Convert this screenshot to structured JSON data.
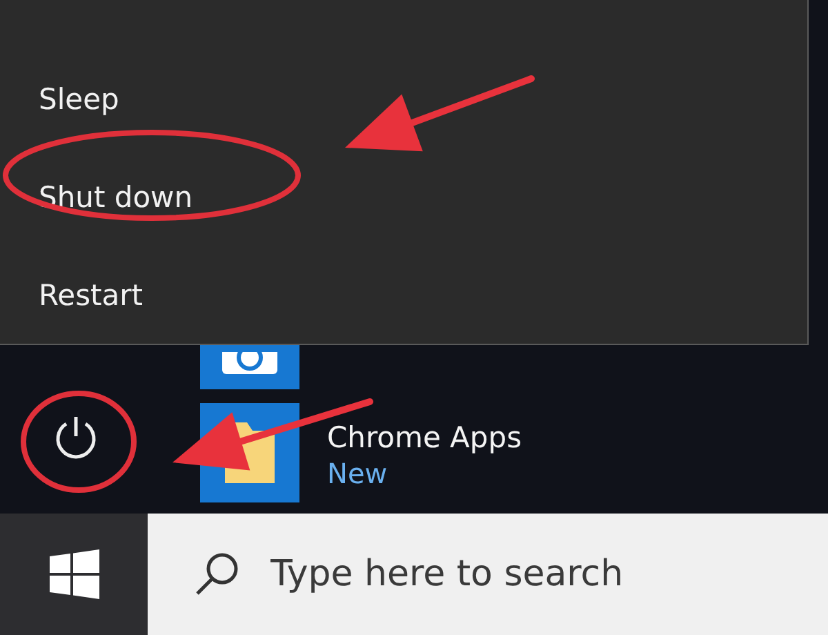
{
  "power_menu": {
    "items": [
      "Sleep",
      "Shut down",
      "Restart"
    ]
  },
  "apps": [
    {
      "kind": "camera"
    },
    {
      "kind": "folder",
      "label": "Chrome Apps",
      "badge": "New"
    }
  ],
  "taskbar": {
    "search": {
      "placeholder": "Type here to search"
    }
  },
  "annotations": [
    {
      "kind": "ellipse"
    },
    {
      "kind": "arrow"
    },
    {
      "kind": "ellipse"
    },
    {
      "kind": "arrow"
    }
  ]
}
